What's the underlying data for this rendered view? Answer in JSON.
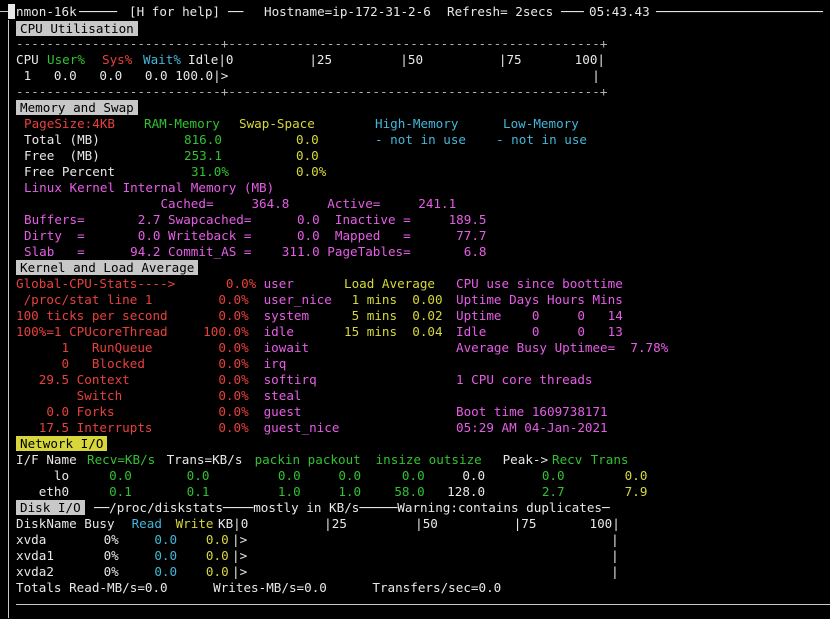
{
  "topbar": {
    "app": "nmon-16k",
    "help": "[H for help]",
    "hostname": "Hostname=ip-172-31-2-6",
    "refresh": "Refresh= 2secs",
    "time": "05:43.43"
  },
  "cpu": {
    "section_title": "CPU Utilisation",
    "dash_line": "---------------------------+-------------------------------------------------+",
    "hdr_cpu": "CPU",
    "hdr_user": "User%",
    "hdr_sys": "Sys%",
    "hdr_wait": "Wait%",
    "hdr_idle": "Idle|0          |25         |50          |75       100|",
    "row": " 1   0.0   0.0   0.0 100.0|>                                                |",
    "bar": {
      "user_pct": 0.0,
      "sys_pct": 0.0,
      "wait_pct": 0.0,
      "idle_pct": 100.0
    }
  },
  "memory": {
    "section_title": "Memory and Swap",
    "pagesize": "PageSize:4KB",
    "ram_label": "RAM-Memory",
    "swap_label": "Swap-Space",
    "high_label": "High-Memory",
    "low_label": "Low-Memory",
    "total_label": "Total (MB)",
    "total_ram": "816.0",
    "total_swap": "0.0",
    "high_value": "- not in use",
    "low_value": "- not in use",
    "free_label": "Free  (MB)",
    "free_ram": "253.1",
    "free_swap": "0.0",
    "freepct_label": "Free Percent",
    "freepct_ram": "31.0%",
    "freepct_swap": "0.0%",
    "kernel_title": "Linux Kernel Internal Memory (MB)",
    "lines": [
      "                  Cached=     364.8     Active=     241.1",
      "Buffers=       2.7 Swapcached=      0.0  Inactive =     189.5",
      "Dirty  =       0.0 Writeback =      0.0  Mapped   =      77.7",
      "Slab   =      94.2 Commit_AS =    311.0 PageTables=       6.8"
    ]
  },
  "kernel": {
    "section_title": "Kernel and Load Average",
    "rows": [
      {
        "a": "Global-CPU-Stats---->",
        "b": "     0.0%",
        "c": " user      ",
        "d": "Load Average",
        "e": "CPU use since boottime"
      },
      {
        "a": " /proc/stat line 1    ",
        "b": "    0.0%",
        "c": " user_nice ",
        "d": " 1 mins  0.00",
        "e": "Uptime Days Hours Mins"
      },
      {
        "a": "100 ticks per second  ",
        "b": "    0.0%",
        "c": " system    ",
        "d": " 5 mins  0.02",
        "e": "Uptime    0     0   14"
      },
      {
        "a": "100%=1 CPUcoreThread  ",
        "b": "  100.0%",
        "c": " idle      ",
        "d": "15 mins  0.04",
        "e": "Idle      0     0   13"
      },
      {
        "a": "      1   RunQueue    ",
        "b": "    0.0%",
        "c": " iowait    ",
        "d": "             ",
        "e": "Average Busy Uptimee=  7.78%"
      },
      {
        "a": "      0   Blocked     ",
        "b": "    0.0%",
        "c": " irq       ",
        "d": "             ",
        "e": ""
      },
      {
        "a": "   29.5 Context       ",
        "b": "    0.0%",
        "c": " softirq   ",
        "d": "             ",
        "e": "1 CPU core threads"
      },
      {
        "a": "        Switch        ",
        "b": "    0.0%",
        "c": " steal     ",
        "d": "             ",
        "e": ""
      },
      {
        "a": "    0.0 Forks         ",
        "b": "    0.0%",
        "c": " guest     ",
        "d": "             ",
        "e": "Boot time 1609738171"
      },
      {
        "a": "   17.5 Interrupts    ",
        "b": "    0.0%",
        "c": " guest_nice",
        "d": "             ",
        "e": "05:29 AM 04-Jan-2021"
      }
    ]
  },
  "network": {
    "section_title": "Network I/O",
    "header": [
      "I/F Name ",
      "Recv=KB/s",
      " Trans=KB/s",
      " packin packout",
      " insize outsize",
      " Peak->",
      "Recv",
      " Trans"
    ],
    "rows": [
      {
        "name": "     lo",
        "recv": "       0.0",
        "trans": "        0.0",
        "packin": "     0.0",
        "packout": "    0.0",
        "insize": "     0.0",
        "outsize": "    0.0",
        "peak_recv": "          0.0",
        "peak_trans": "        0.0"
      },
      {
        "name": "   eth0",
        "recv": "       0.1",
        "trans": "        0.1",
        "packin": "     1.0",
        "packout": "    1.0",
        "insize": "    58.0",
        "outsize": "  128.0",
        "peak_recv": "          2.7",
        "peak_trans": "        7.9"
      }
    ]
  },
  "disk": {
    "section_title": "Disk I/O",
    "title_tail": "──/proc/diskstats────mostly in KB/s─────Warning:contains duplicates─",
    "header_a": "DiskName Busy ",
    "header_read": " Read",
    "header_write": " Write",
    "header_tail": "KB|0          |25         |50          |75       100|",
    "rows": [
      {
        "name": "xvda      ",
        "busy": " 0%  ",
        "read": "    0.0",
        "write": "     0.0",
        "bar": "|>                                                |"
      },
      {
        "name": "xvda1     ",
        "busy": " 0%  ",
        "read": "    0.0",
        "write": "     0.0",
        "bar": "|>                                                |"
      },
      {
        "name": "xvda2     ",
        "busy": " 0%  ",
        "read": "    0.0",
        "write": "     0.0",
        "bar": "|>                                                |"
      }
    ],
    "totals": "Totals Read-MB/s=0.0      Writes-MB/s=0.0      Transfers/sec=0.0"
  }
}
